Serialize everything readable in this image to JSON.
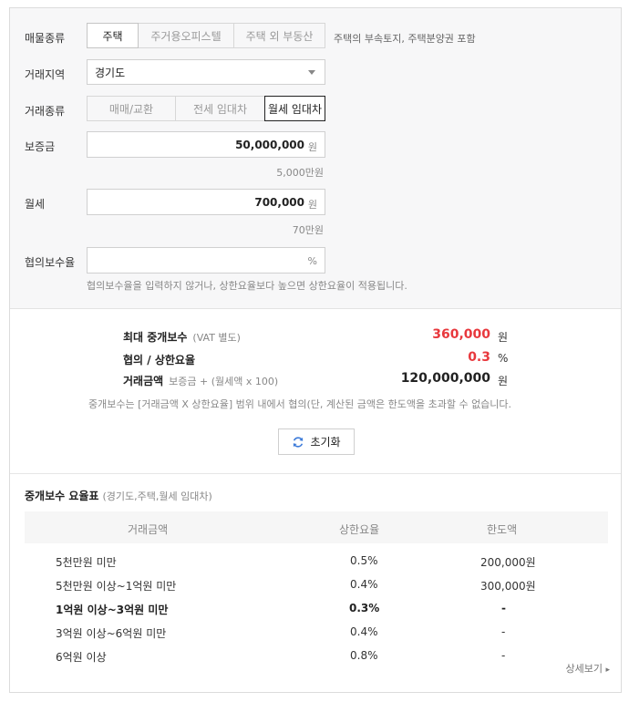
{
  "property": {
    "label": "매물종류",
    "options": [
      "주택",
      "주거용오피스텔",
      "주택 외 부동산"
    ],
    "selected": "주택",
    "note": "주택의 부속토지, 주택분양권 포함"
  },
  "region": {
    "label": "거래지역",
    "value": "경기도"
  },
  "trade": {
    "label": "거래종류",
    "options": [
      "매매/교환",
      "전세 임대차",
      "월세 임대차"
    ],
    "selected": "월세 임대차"
  },
  "deposit": {
    "label": "보증금",
    "value": "50,000,000",
    "unit": "원",
    "hint": "5,000만원"
  },
  "monthly": {
    "label": "월세",
    "value": "700,000",
    "unit": "원",
    "hint": "70만원"
  },
  "rate": {
    "label": "협의보수율",
    "value": "",
    "unit": "%",
    "note": "협의보수율을 입력하지 않거나, 상한요율보다 높으면 상한요율이 적용됩니다."
  },
  "result": {
    "max_fee": {
      "label": "최대 중개보수",
      "sub": "(VAT 별도)",
      "value": "360,000",
      "unit": "원"
    },
    "rate": {
      "label": "협의 / 상한요율",
      "value": "0.3",
      "unit": "%"
    },
    "amount": {
      "label": "거래금액",
      "sub": "보증금 + (월세액 x 100)",
      "value": "120,000,000",
      "unit": "원"
    },
    "note": "중개보수는 [거래금액 X 상한요율] 범위 내에서 협의(단, 계산된 금액은 한도액을 초과할 수 없습니다.",
    "reset_label": "초기화"
  },
  "table": {
    "title": "중개보수 요율표",
    "subtitle": "(경기도,주택,월세 임대차)",
    "headers": [
      "거래금액",
      "상한요율",
      "한도액"
    ],
    "rows": [
      [
        "5천만원 미만",
        "0.5%",
        "200,000원"
      ],
      [
        "5천만원 이상~1억원 미만",
        "0.4%",
        "300,000원"
      ],
      [
        "1억원 이상~3억원 미만",
        "0.3%",
        "-"
      ],
      [
        "3억원 이상~6억원 미만",
        "0.4%",
        "-"
      ],
      [
        "6억원 이상",
        "0.8%",
        "-"
      ]
    ],
    "highlight_row": 2,
    "more_label": "상세보기",
    "more_icon": "chevron-right-icon"
  },
  "colors": {
    "accent_red": "#e8383d",
    "refresh_blue": "#3d7bd9"
  }
}
